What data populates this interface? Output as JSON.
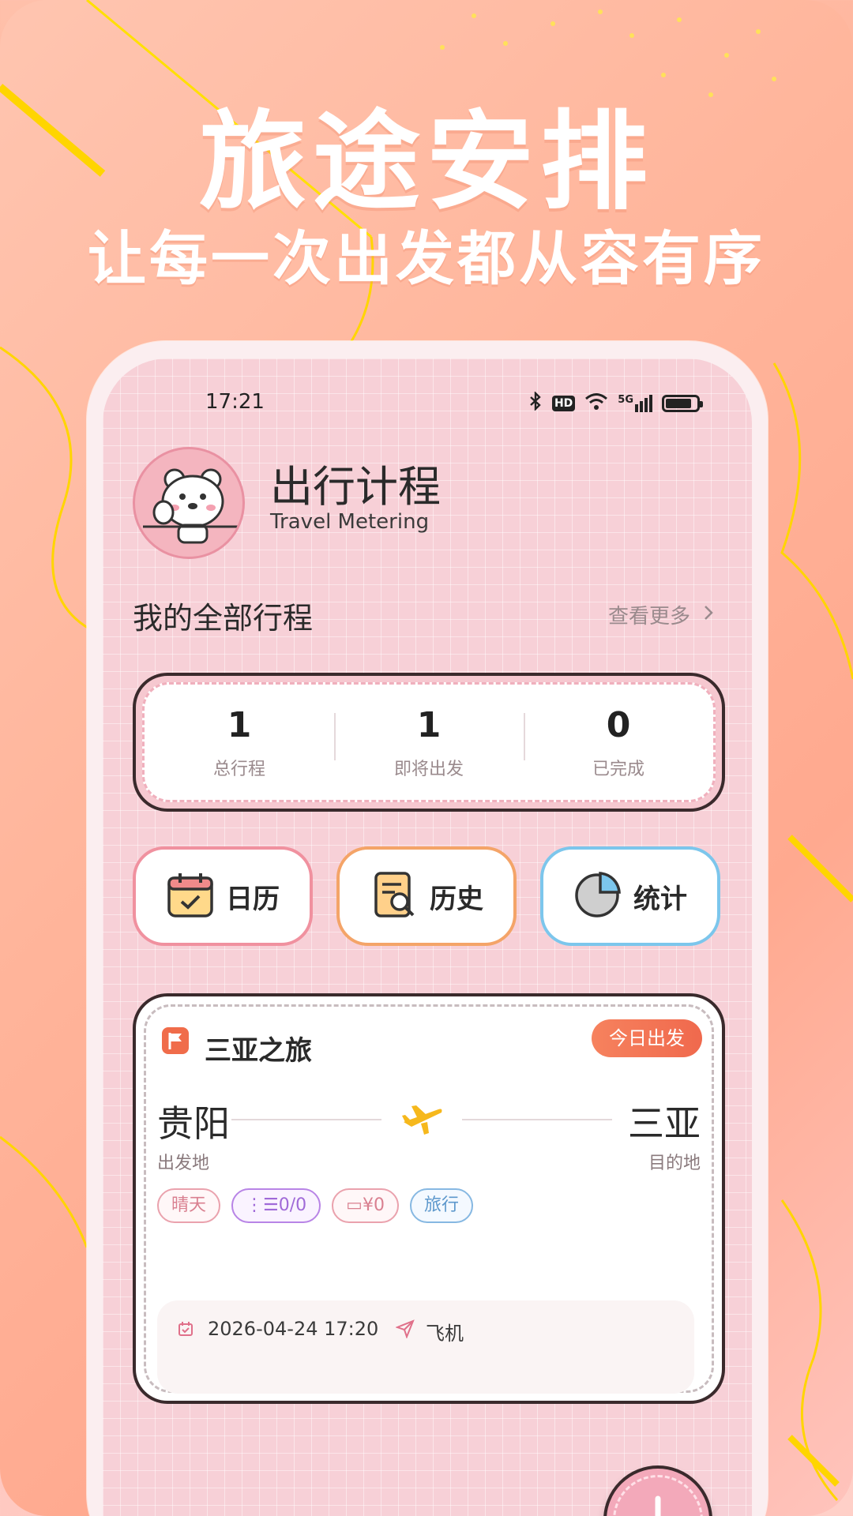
{
  "promo": {
    "title": "旅途安排",
    "subtitle": "让每一次出发都从容有序"
  },
  "status_bar": {
    "time": "17:21",
    "icons": [
      "bluetooth-icon",
      "hd-icon",
      "wifi-icon",
      "5g-signal-icon",
      "battery-icon"
    ],
    "hd_label": "HD",
    "net_label": "5G",
    "battery_level": 0.85
  },
  "header": {
    "title": "出行计程",
    "subtitle": "Travel Metering",
    "avatar": "polar-bear-avatar"
  },
  "section": {
    "title": "我的全部行程",
    "see_more": "查看更多",
    "see_more_icon": "chevron-right-icon"
  },
  "stats": [
    {
      "value": "1",
      "label": "总行程"
    },
    {
      "value": "1",
      "label": "即将出发"
    },
    {
      "value": "0",
      "label": "已完成"
    }
  ],
  "quick_actions": [
    {
      "label": "日历",
      "icon": "calendar-check-icon"
    },
    {
      "label": "历史",
      "icon": "history-document-icon"
    },
    {
      "label": "统计",
      "icon": "pie-chart-icon"
    }
  ],
  "trip": {
    "title": "三亚之旅",
    "badge": "今日出发",
    "from_city": "贵阳",
    "from_label": "出发地",
    "to_city": "三亚",
    "to_label": "目的地",
    "tags": {
      "weather": "晴天",
      "checklist": "0/0",
      "budget": "¥0",
      "type": "旅行"
    },
    "datetime": "2026-04-24 17:20",
    "transport": "飞机"
  },
  "colors": {
    "accent_pink": "#f3a9ba",
    "badge_orange": "#f0694d",
    "outline_dark": "#3a2a2c"
  }
}
